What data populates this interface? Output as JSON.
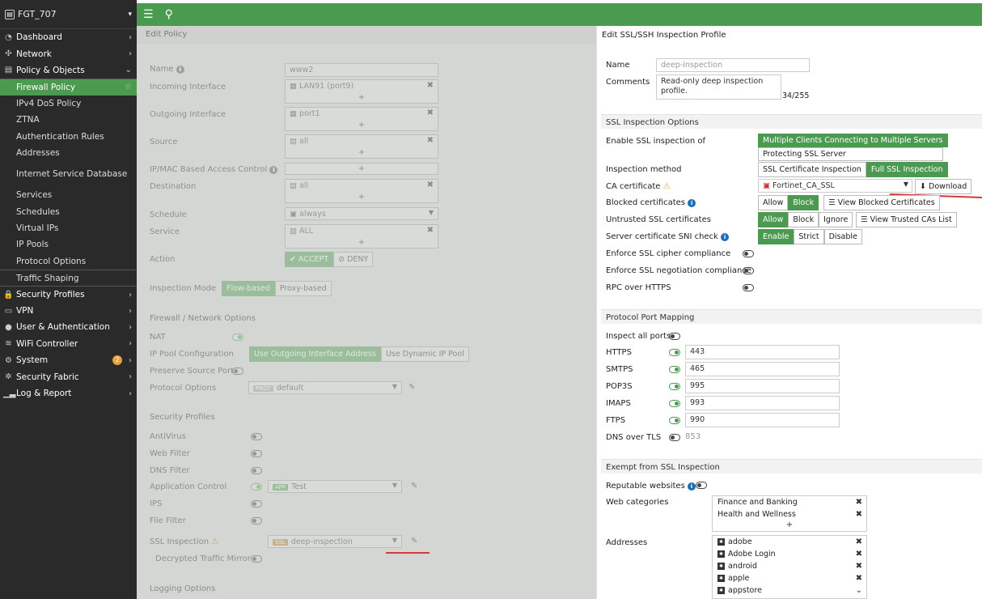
{
  "device": {
    "name": "FGT_707"
  },
  "sidebar": {
    "items": [
      {
        "label": "Dashboard",
        "icon": "dashboard-icon",
        "glyph": "◔",
        "chevron": "›"
      },
      {
        "label": "Network",
        "icon": "network-icon",
        "glyph": "✣",
        "chevron": "›"
      },
      {
        "label": "Policy & Objects",
        "icon": "policy-icon",
        "glyph": "▤",
        "chevron": "⌄"
      },
      {
        "label": "Firewall Policy",
        "sub": true,
        "active": true
      },
      {
        "label": "IPv4 DoS Policy",
        "sub": true
      },
      {
        "label": "ZTNA",
        "sub": true
      },
      {
        "label": "Authentication Rules",
        "sub": true
      },
      {
        "label": "Addresses",
        "sub": true
      },
      {
        "label": "Internet Service Database",
        "sub": true
      },
      {
        "label": "Services",
        "sub": true
      },
      {
        "label": "Schedules",
        "sub": true
      },
      {
        "label": "Virtual IPs",
        "sub": true
      },
      {
        "label": "IP Pools",
        "sub": true
      },
      {
        "label": "Protocol Options",
        "sub": true
      },
      {
        "label": "Traffic Shaping",
        "sub": true
      },
      {
        "label": "Security Profiles",
        "icon": "lock-icon",
        "glyph": "🔒",
        "chevron": "›"
      },
      {
        "label": "VPN",
        "icon": "monitor-icon",
        "glyph": "▭",
        "chevron": "›"
      },
      {
        "label": "User & Authentication",
        "icon": "user-icon",
        "glyph": "●",
        "chevron": "›"
      },
      {
        "label": "WiFi Controller",
        "icon": "wifi-icon",
        "glyph": "≋",
        "chevron": "›"
      },
      {
        "label": "System",
        "icon": "gear-icon",
        "glyph": "⚙",
        "chevron": "›",
        "badge": "2"
      },
      {
        "label": "Security Fabric",
        "icon": "fabric-icon",
        "glyph": "✲",
        "chevron": "›"
      },
      {
        "label": "Log & Report",
        "icon": "chart-icon",
        "glyph": "▁▃",
        "chevron": "›"
      }
    ]
  },
  "policy": {
    "header": "Edit Policy",
    "name_label": "Name",
    "name_value": "www2",
    "incoming_label": "Incoming Interface",
    "incoming_value": "LAN91 (port9)",
    "outgoing_label": "Outgoing Interface",
    "outgoing_value": "port1",
    "source_label": "Source",
    "source_value": "all",
    "ipmac_label": "IP/MAC Based Access Control",
    "destination_label": "Destination",
    "destination_value": "all",
    "schedule_label": "Schedule",
    "schedule_value": "always",
    "service_label": "Service",
    "service_value": "ALL",
    "action_label": "Action",
    "accept": "ACCEPT",
    "deny": "DENY",
    "inspection_label": "Inspection Mode",
    "flow": "Flow-based",
    "proxy": "Proxy-based",
    "fw_section": "Firewall / Network Options",
    "nat": "NAT",
    "ippool": "IP Pool Configuration",
    "use_out": "Use Outgoing Interface Address",
    "use_dyn": "Use Dynamic IP Pool",
    "preserve": "Preserve Source Port",
    "protocol": "Protocol Options",
    "prot_tag": "PROT",
    "protocol_value": "default",
    "sp_section": "Security Profiles",
    "antivirus": "AntiVirus",
    "webfilter": "Web Filter",
    "dnsfilter": "DNS Filter",
    "appcontrol": "Application Control",
    "app_tag": "APP",
    "app_value": "Test",
    "ips": "IPS",
    "filefilter": "File Filter",
    "sslinsp": "SSL Inspection",
    "ssl_tag": "SSL",
    "ssl_value": "deep-inspection",
    "decrypted": "Decrypted Traffic Mirror",
    "logging": "Logging Options"
  },
  "panel": {
    "title": "Edit SSL/SSH Inspection Profile",
    "name_label": "Name",
    "name_value": "deep-inspection",
    "comments_label": "Comments",
    "comments_value": "Read-only deep inspection profile.",
    "comments_count": "34/255",
    "ssl_section": "SSL Inspection Options",
    "enable_label": "Enable SSL inspection of",
    "enable_opt1": "Multiple Clients Connecting to Multiple Servers",
    "enable_opt2": "Protecting SSL Server",
    "method_label": "Inspection method",
    "method_opt1": "SSL Certificate Inspection",
    "method_opt2": "Full SSL Inspection",
    "ca_label": "CA certificate",
    "ca_value": "Fortinet_CA_SSL",
    "download": "Download",
    "blocked_label": "Blocked certificates",
    "allow": "Allow",
    "block": "Block",
    "view_blocked": "View Blocked Certificates",
    "untrusted_label": "Untrusted SSL certificates",
    "ignore": "Ignore",
    "view_trusted": "View Trusted CAs List",
    "sni_label": "Server certificate SNI check",
    "enable": "Enable",
    "strict": "Strict",
    "disable": "Disable",
    "cipher_label": "Enforce SSL cipher compliance",
    "negotiation_label": "Enforce SSL negotiation compliance",
    "rpc_label": "RPC over HTTPS",
    "port_section": "Protocol Port Mapping",
    "inspect_all": "Inspect all ports",
    "ports": [
      {
        "name": "HTTPS",
        "value": "443"
      },
      {
        "name": "SMTPS",
        "value": "465"
      },
      {
        "name": "POP3S",
        "value": "995"
      },
      {
        "name": "IMAPS",
        "value": "993"
      },
      {
        "name": "FTPS",
        "value": "990"
      }
    ],
    "dns_tls": "DNS over TLS",
    "dns_tls_port": "853",
    "exempt_section": "Exempt from SSL Inspection",
    "reputable": "Reputable websites",
    "webcat_label": "Web categories",
    "webcats": [
      "Finance and Banking",
      "Health and Wellness"
    ],
    "addr_label": "Addresses",
    "addresses": [
      "adobe",
      "Adobe Login",
      "android",
      "apple",
      "appstore"
    ]
  }
}
